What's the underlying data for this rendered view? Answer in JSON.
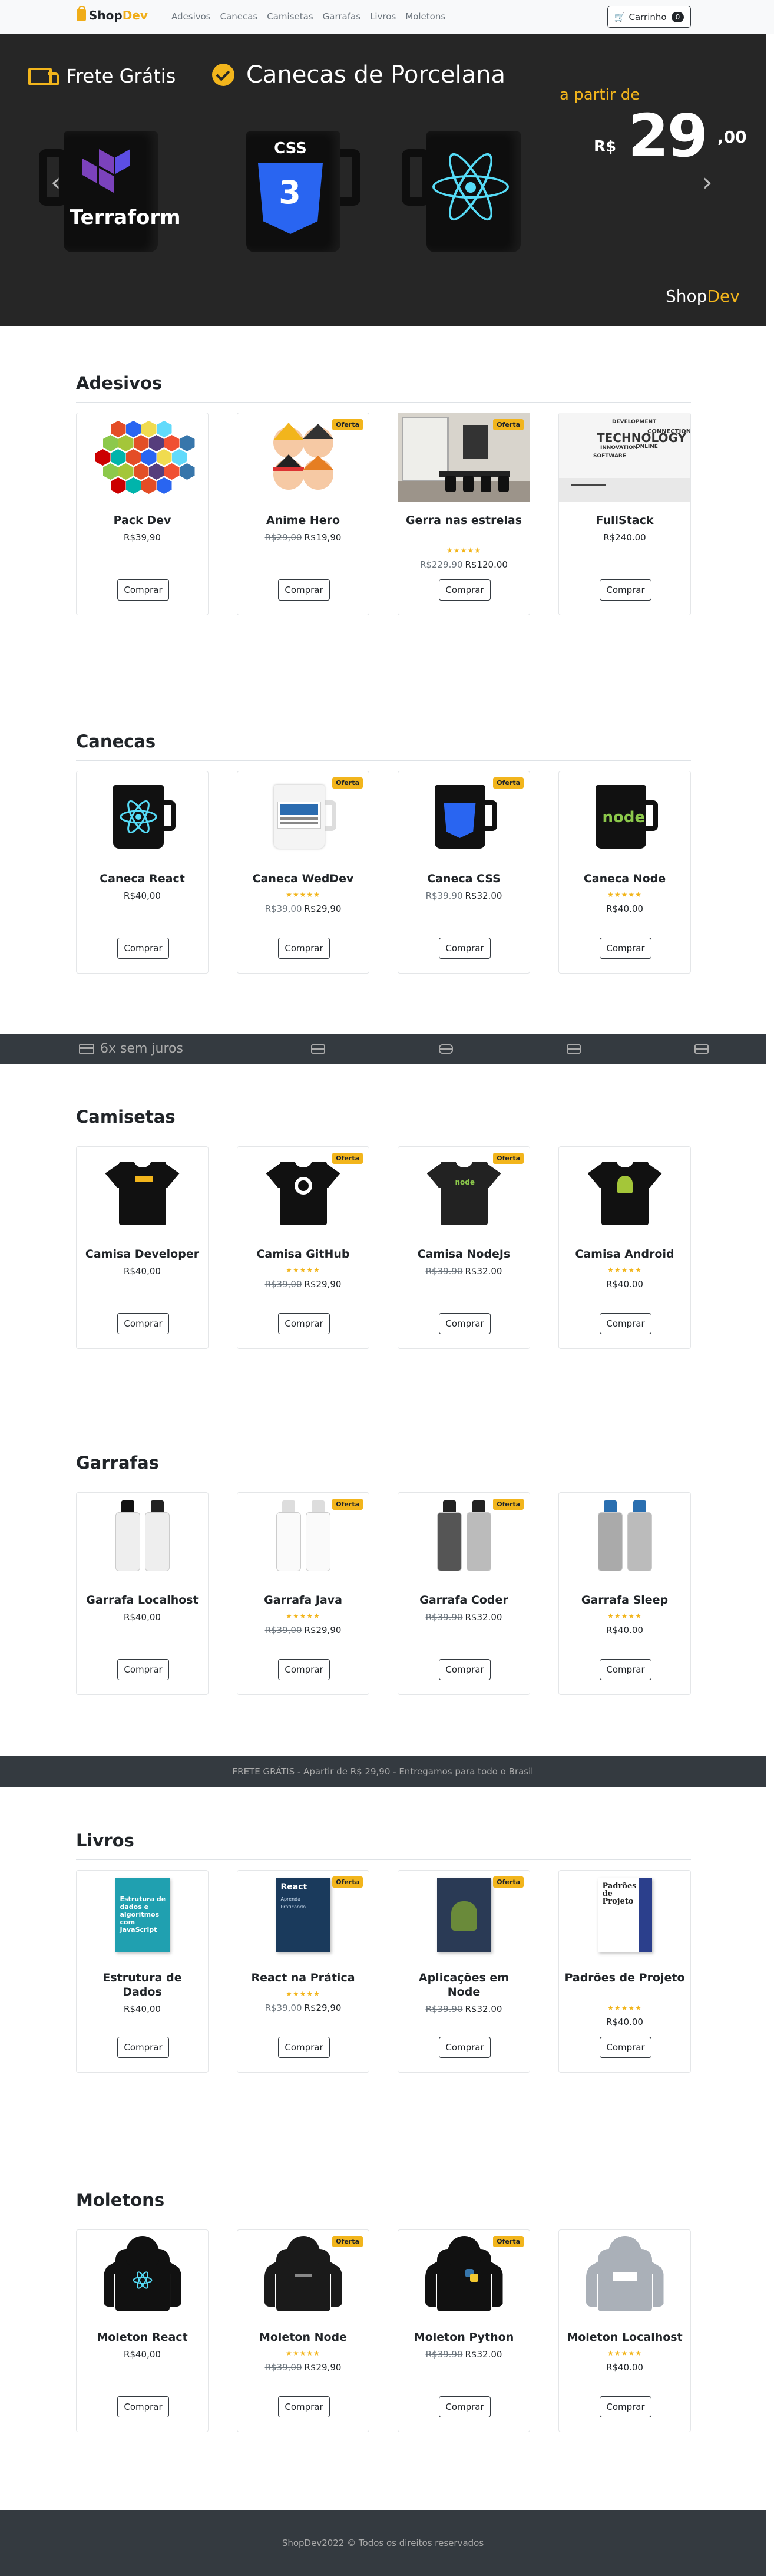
{
  "nav": {
    "brand_shop": "Shop",
    "brand_dev": "Dev",
    "links": [
      "Adesivos",
      "Canecas",
      "Camisetas",
      "Garrafas",
      "Livros",
      "Moletons"
    ],
    "cart_label": "Carrinho",
    "cart_count": "0"
  },
  "hero": {
    "frete": "Frete Grátis",
    "canecas": "Canecas de Porcelana",
    "apartir": "a partir de",
    "currency": "R$",
    "price_int": "29",
    "price_cents": ",00",
    "logo_shop": "Shop",
    "logo_dev": "Dev",
    "mug_tf_text": "Terraform",
    "mug_css_text": "CSS",
    "mug_css_num": "3",
    "prev_arrow": "‹",
    "next_arrow": "›"
  },
  "colors": {
    "accent": "#f2b51c",
    "dark": "#343a40",
    "hero_bg": "#262626",
    "react": "#56dcf7",
    "css": "#2965f1"
  },
  "buy_label": "Comprar",
  "offer_label": "Oferta",
  "stars": "★★★★★",
  "sections": [
    {
      "title": "Adesivos",
      "products": [
        {
          "name": "Pack Dev",
          "price": "R$39,90",
          "old": "",
          "offer": false,
          "stars": false,
          "art": "hexes"
        },
        {
          "name": "Anime Hero",
          "price": "R$19,90",
          "old": "R$29,00",
          "offer": true,
          "stars": false,
          "art": "anime"
        },
        {
          "name": "Gerra nas estrelas",
          "price": "R$120.00",
          "old": "R$229.90",
          "offer": true,
          "stars": true,
          "art": "office"
        },
        {
          "name": "FullStack",
          "price": "R$240.00",
          "old": "",
          "offer": false,
          "stars": false,
          "art": "wordcloud"
        }
      ]
    },
    {
      "title": "Canecas",
      "products": [
        {
          "name": "Caneca React",
          "price": "R$40,00",
          "old": "",
          "offer": false,
          "stars": false,
          "art": "mug-react"
        },
        {
          "name": "Caneca WedDev",
          "price": "R$29,90",
          "old": "R$39,00",
          "offer": true,
          "stars": true,
          "art": "mug-white"
        },
        {
          "name": "Caneca CSS",
          "price": "R$32.00",
          "old": "R$39.90",
          "offer": true,
          "stars": false,
          "art": "mug-css"
        },
        {
          "name": "Caneca Node",
          "price": "R$40.00",
          "old": "",
          "offer": false,
          "stars": true,
          "art": "mug-node"
        }
      ]
    },
    {
      "title": "Camisetas",
      "products": [
        {
          "name": "Camisa Developer",
          "price": "R$40,00",
          "old": "",
          "offer": false,
          "stars": false,
          "art": "shirt-dev"
        },
        {
          "name": "Camisa GitHub",
          "price": "R$29,90",
          "old": "R$39,00",
          "offer": true,
          "stars": true,
          "art": "shirt-github"
        },
        {
          "name": "Camisa NodeJs",
          "price": "R$32.00",
          "old": "R$39.90",
          "offer": true,
          "stars": false,
          "art": "shirt-node"
        },
        {
          "name": "Camisa Android",
          "price": "R$40.00",
          "old": "",
          "offer": false,
          "stars": true,
          "art": "shirt-android"
        }
      ]
    },
    {
      "title": "Garrafas",
      "products": [
        {
          "name": "Garrafa Localhost",
          "price": "R$40,00",
          "old": "",
          "offer": false,
          "stars": false,
          "art": "bottle-white"
        },
        {
          "name": "Garrafa Java",
          "price": "R$29,90",
          "old": "R$39,00",
          "offer": true,
          "stars": true,
          "art": "bottle-java"
        },
        {
          "name": "Garrafa Coder",
          "price": "R$32.00",
          "old": "R$39.90",
          "offer": true,
          "stars": false,
          "art": "bottle-coder"
        },
        {
          "name": "Garrafa Sleep",
          "price": "R$40.00",
          "old": "",
          "offer": false,
          "stars": true,
          "art": "bottle-sleep"
        }
      ]
    },
    {
      "title": "Livros",
      "products": [
        {
          "name": "Estrutura de Dados",
          "price": "R$40,00",
          "old": "",
          "offer": false,
          "stars": false,
          "art": "book-estrutura"
        },
        {
          "name": "React na Prática",
          "price": "R$29,90",
          "old": "R$39,00",
          "offer": true,
          "stars": true,
          "art": "book-react"
        },
        {
          "name": "Aplicações em Node",
          "price": "R$32.00",
          "old": "R$39.90",
          "offer": true,
          "stars": false,
          "art": "book-node"
        },
        {
          "name": "Padrões de Projeto",
          "price": "R$40.00",
          "old": "",
          "offer": false,
          "stars": true,
          "art": "book-padroes"
        }
      ]
    },
    {
      "title": "Moletons",
      "products": [
        {
          "name": "Moleton React",
          "price": "R$40,00",
          "old": "",
          "offer": false,
          "stars": false,
          "art": "hood-react"
        },
        {
          "name": "Moleton Node",
          "price": "R$29,90",
          "old": "R$39,00",
          "offer": true,
          "stars": true,
          "art": "hood-node"
        },
        {
          "name": "Moleton Python",
          "price": "R$32.00",
          "old": "R$39.90",
          "offer": true,
          "stars": false,
          "art": "hood-python"
        },
        {
          "name": "Moleton Localhost",
          "price": "R$40.00",
          "old": "",
          "offer": false,
          "stars": true,
          "art": "hood-grey"
        }
      ]
    }
  ],
  "payband": {
    "installments": "6x sem juros",
    "icons": [
      "barcode-icon",
      "pix-icon",
      "credit-card-icon",
      "debit-card-icon"
    ]
  },
  "freteband": "FRETE GRÁTIS - Apartir de R$ 29,90 - Entregamos para todo o Brasil",
  "footer": "ShopDev2022 © Todos os direitos reservados",
  "book_titles": {
    "estrutura": "Estrutura de dados e algoritmos com JavaScript",
    "react": "React",
    "react_sub": "Aprenda Praticando",
    "padroes": "Padrões de Projeto"
  }
}
